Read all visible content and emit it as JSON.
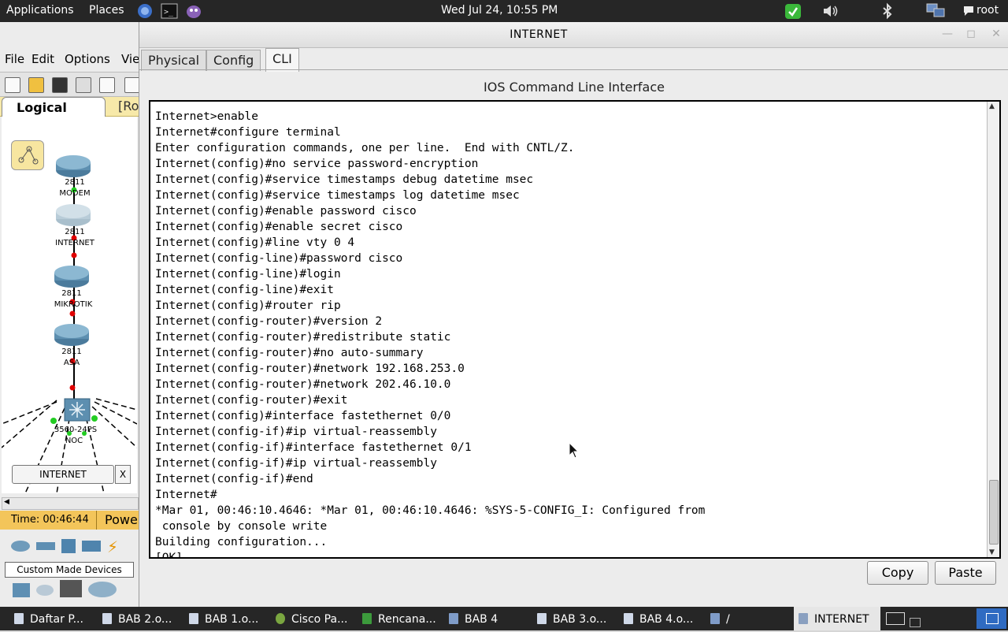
{
  "top_panel": {
    "applications": "Applications",
    "places": "Places",
    "clock": "Wed Jul 24, 10:55 PM",
    "user": "root",
    "icons": [
      "firefox-icon",
      "terminal-icon",
      "pidgin-icon",
      "update-icon",
      "volume-icon",
      "bluetooth-icon",
      "network-icon",
      "chat-icon"
    ]
  },
  "pt": {
    "menu": [
      "File",
      "Edit",
      "Options",
      "Vie"
    ],
    "logical_tab": "Logical",
    "root_label": "[Ro",
    "devices": [
      {
        "model": "2811",
        "name": "MODEM"
      },
      {
        "model": "2811",
        "name": "INTERNET"
      },
      {
        "model": "2811",
        "name": "MIKROTIK"
      },
      {
        "model": "2811",
        "name": "ASA"
      },
      {
        "model": "3560-24PS",
        "name": "NOC"
      }
    ],
    "canvas_tab": "INTERNET",
    "canvas_close": "X",
    "time": "Time: 00:46:44",
    "power": "Powe",
    "custom_devices": "Custom Made Devices"
  },
  "window": {
    "title": "INTERNET",
    "tabs": [
      "Physical",
      "Config",
      "CLI"
    ],
    "active_tab": "CLI",
    "heading": "IOS Command Line Interface",
    "copy": "Copy",
    "paste": "Paste",
    "terminal_lines": [
      "Internet>enable",
      "Internet#configure terminal",
      "Enter configuration commands, one per line.  End with CNTL/Z.",
      "Internet(config)#no service password-encryption",
      "Internet(config)#service timestamps debug datetime msec",
      "Internet(config)#service timestamps log datetime msec",
      "Internet(config)#enable password cisco",
      "Internet(config)#enable secret cisco",
      "Internet(config)#line vty 0 4",
      "Internet(config-line)#password cisco",
      "Internet(config-line)#login",
      "Internet(config-line)#exit",
      "Internet(config)#router rip",
      "Internet(config-router)#version 2",
      "Internet(config-router)#redistribute static",
      "Internet(config-router)#no auto-summary",
      "Internet(config-router)#network 192.168.253.0",
      "Internet(config-router)#network 202.46.10.0",
      "Internet(config-router)#exit",
      "Internet(config)#interface fastethernet 0/0",
      "Internet(config-if)#ip virtual-reassembly",
      "Internet(config-if)#interface fastethernet 0/1",
      "Internet(config-if)#ip virtual-reassembly",
      "Internet(config-if)#end",
      "Internet#",
      "*Mar 01, 00:46:10.4646: *Mar 01, 00:46:10.4646: %SYS-5-CONFIG_I: Configured from",
      " console by console write",
      "Building configuration...",
      "[OK]"
    ]
  },
  "taskbar": {
    "items": [
      {
        "label": "Daftar P...",
        "icon": "document-icon"
      },
      {
        "label": "BAB 2.o...",
        "icon": "document-icon"
      },
      {
        "label": "BAB 1.o...",
        "icon": "document-icon"
      },
      {
        "label": "Cisco Pa...",
        "icon": "packet-tracer-icon"
      },
      {
        "label": "Rencana...",
        "icon": "spreadsheet-icon"
      },
      {
        "label": "BAB 4",
        "icon": "folder-icon"
      },
      {
        "label": "BAB 3.o...",
        "icon": "document-icon"
      },
      {
        "label": "BAB 4.o...",
        "icon": "document-icon"
      },
      {
        "label": "/",
        "icon": "folder-icon"
      },
      {
        "label": "INTERNET",
        "icon": "window-icon"
      }
    ]
  }
}
